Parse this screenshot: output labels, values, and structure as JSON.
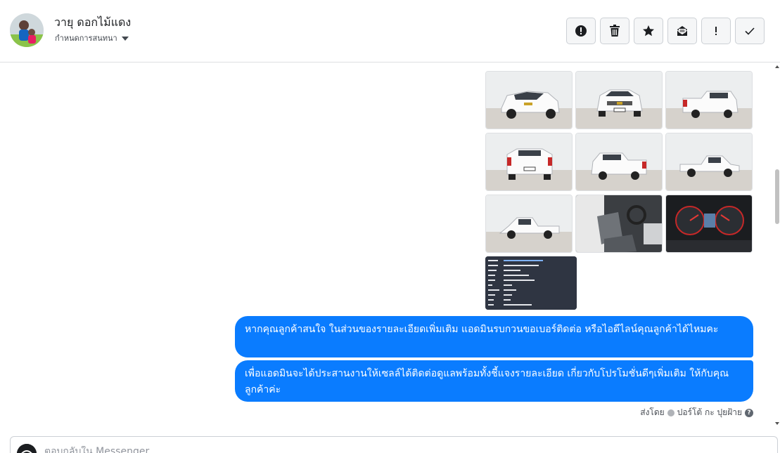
{
  "header": {
    "contact_name": "วายุ ดอกไม้แดง",
    "assign_label": "กำหนดการสนทนา",
    "actions": [
      {
        "name": "spam-button",
        "icon": "alert-circle-icon"
      },
      {
        "name": "delete-button",
        "icon": "trash-icon"
      },
      {
        "name": "star-button",
        "icon": "star-icon"
      },
      {
        "name": "mark-unread-button",
        "icon": "envelope-icon"
      },
      {
        "name": "follow-up-button",
        "icon": "exclamation-icon"
      },
      {
        "name": "mark-done-button",
        "icon": "check-icon"
      }
    ]
  },
  "conversation": {
    "photos": [
      {
        "label": "car-front-left"
      },
      {
        "label": "car-front"
      },
      {
        "label": "car-rear-right"
      },
      {
        "label": "car-rear"
      },
      {
        "label": "car-rear-left"
      },
      {
        "label": "car-side-right"
      },
      {
        "label": "car-side-left"
      },
      {
        "label": "car-interior-seat"
      },
      {
        "label": "car-dashboard-gauges"
      }
    ],
    "messages": [
      {
        "text": "หากคุณลูกค้าสนใจ ในส่วนของรายละเอียดเพิ่มเติม แอดมินรบกวนขอเบอร์ติดต่อ หรือไอดีไลน์คุณลูกค้าได้ไหมคะ"
      },
      {
        "text": "เพื่อแอดมินจะได้ประสานงานให้เซลล์ได้ติดต่อดูแลพร้อมทั้งชี้แจงรายละเอียด เกี่ยวกับโปรโมชั่นดีๆเพิ่มเติม ให้กับคุณลูกค้าค่ะ"
      }
    ],
    "sent_by_prefix": "ส่งโดย",
    "sent_by_name": "ปอร์โต้ กะ ปุยฝ้าย"
  },
  "composer": {
    "placeholder": "ตอบกลับใน Messenger"
  },
  "colors": {
    "bubble": "#0a7cff",
    "border": "#dddfe2"
  }
}
